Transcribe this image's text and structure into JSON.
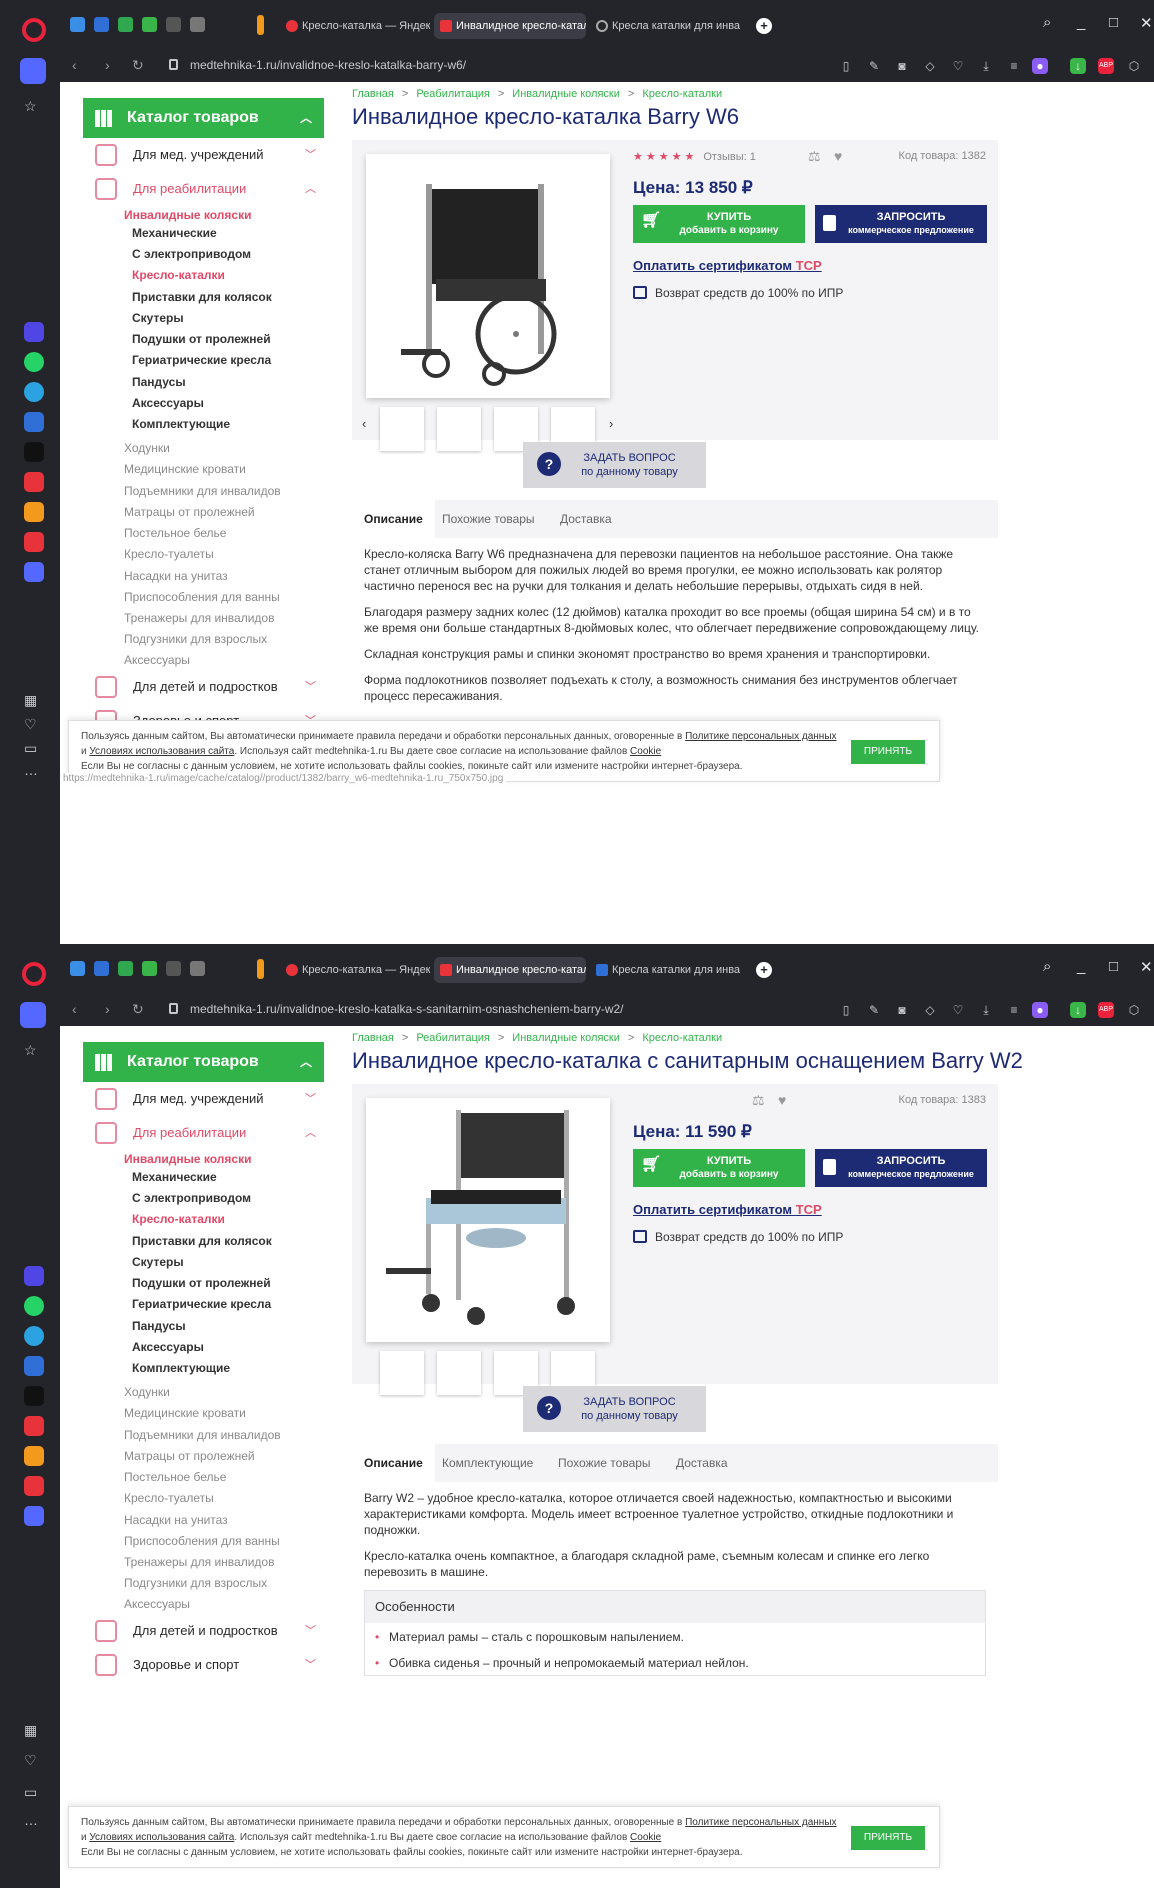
{
  "tabs": [
    "Кресло-каталка — Яндек",
    "Инвалидное кресло-катал",
    "Кресла каталки для инва"
  ],
  "catalog": {
    "title": "Каталог товаров",
    "cats_top": [
      "Для мед. учреждений",
      "Для реабилитации"
    ],
    "sub_bold": [
      "Инвалидные коляски",
      "Механические",
      "С электроприводом",
      "Кресло-каталки",
      "Приставки для колясок",
      "Скутеры",
      "Подушки от пролежней",
      "Гериатрические кресла",
      "Пандусы",
      "Аксессуары",
      "Комплектующие"
    ],
    "sub_gray": [
      "Ходунки",
      "Медицинские кровати",
      "Подъемники для инвалидов",
      "Матрацы от пролежней",
      "Постельное белье",
      "Кресло-туалеты",
      "Насадки на унитаз",
      "Приспособления для ванны",
      "Тренажеры для инвалидов",
      "Подгузники для взрослых",
      "Аксессуары"
    ],
    "cats_bottom": [
      "Для детей и подростков",
      "Здоровье и спорт"
    ]
  },
  "breadcrumb": [
    "Главная",
    "Реабилитация",
    "Инвалидные коляски",
    "Кресло-каталки"
  ],
  "common": {
    "buy": "КУПИТЬ",
    "buy_sub": "добавить в корзину",
    "req": "ЗАПРОСИТЬ",
    "req_sub": "коммерческое предложение",
    "cert": "Оплатить сертификатом",
    "cert_red": "ТСР",
    "refund": "Возврат средств до 100% по ИПР",
    "ask": "ЗАДАТЬ ВОПРОС",
    "ask_sub": "по данному товару",
    "cookie1": "Пользуясь данным сайтом, Вы автоматически принимаете правила передачи и обработки персональных данных, оговоренные в",
    "cookie_link1": "Политике персональных данных",
    "cookie_and": "и",
    "cookie_link2": "Условиях использования сайта",
    "cookie2": ". Используя сайт medtehnika-1.ru Вы даете свое согласие на использование файлов",
    "cookie_link3": "Cookie",
    "cookie3": "Если Вы не согласны с данным условием, не хотите использовать файлы cookies, покиньте сайт или измените настройки интернет-браузера.",
    "accept": "ПРИНЯТЬ"
  },
  "p1": {
    "url": "medtehnika-1.ru/invalidnoe-kreslo-katalka-barry-w6/",
    "title": "Инвалидное кресло-каталка Barry W6",
    "rating_label": "Отзывы: 1",
    "sku": "Код товара: 1382",
    "price": "Цена: 13 850 ₽",
    "tabs": [
      "Описание",
      "Похожие товары",
      "Доставка"
    ],
    "desc": [
      "Кресло-коляска Barry W6 предназначена для перевозки пациентов на небольшое расстояние. Она также станет отличным выбором для пожилых людей во время прогулки, ее можно использовать как ролятор частично перенося вес на ручки для толкания и делать небольшие перерывы, отдыхать сидя в ней.",
      "Благодаря размеру задних колес (12 дюймов) каталка проходит во все проемы (общая ширина 54 см) и в то же время они больше стандартных 8-дюймовых колес, что облегчает передвижение сопровождающему лицу.",
      "Складная конструкция рамы и спинки экономят пространство во время хранения и транспортировки.",
      "Форма подлокотников позволяет подъехать к столу, а возможность снимания без инструментов облегчает процесс пересаживания."
    ],
    "status": "https://medtehnika-1.ru/image/cache/catalog//product/1382/barry_w6-medtehnika-1.ru_750x750.jpg"
  },
  "p2": {
    "url": "medtehnika-1.ru/invalidnoe-kreslo-katalka-s-sanitarnim-osnashcheniem-barry-w2/",
    "title": "Инвалидное кресло-каталка с санитарным оснащением Barry W2",
    "sku": "Код товара: 1383",
    "price": "Цена: 11 590 ₽",
    "tabs": [
      "Описание",
      "Комплектующие",
      "Похожие товары",
      "Доставка"
    ],
    "desc": [
      "Barry W2 – удобное кресло-каталка, которое отличается своей надежностью, компактностью и высокими характеристиками комфорта. Модель имеет встроенное туалетное устройство, откидные подлокотники и подножки.",
      "Кресло-каталка очень компактное, а благодаря складной раме, съемным колесам и спинке его легко перевозить в машине."
    ],
    "features_title": "Особенности",
    "features": [
      "Материал рамы – сталь с порошковым напылением.",
      "Обивка сиденья – прочный и непромокаемый материал нейлон."
    ]
  }
}
